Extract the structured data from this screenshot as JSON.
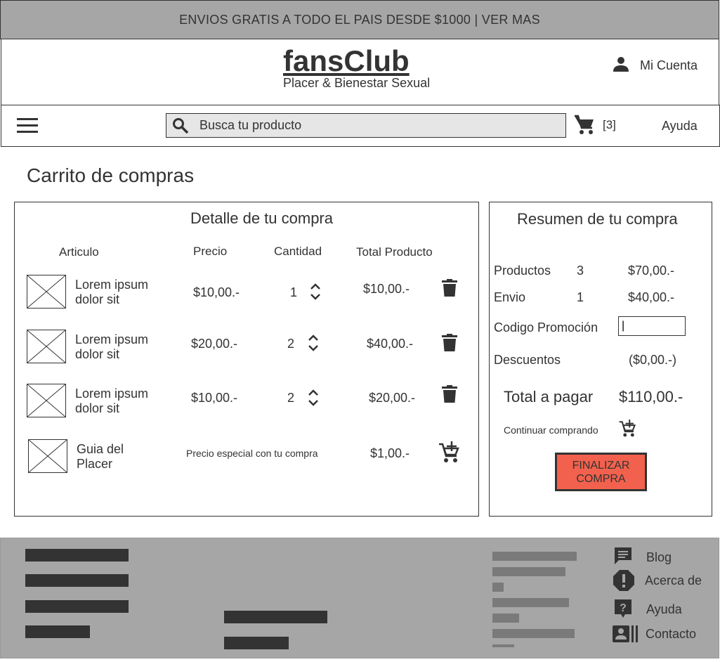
{
  "banner": {
    "text": "ENVIOS GRATIS A TODO EL PAIS DESDE $1000 | VER MAS"
  },
  "header": {
    "brand": "fansClub",
    "tagline": "Placer & Bienestar Sexual",
    "account_label": "Mi Cuenta",
    "account_icon": "person-icon"
  },
  "nav": {
    "menu_icon": "hamburger-menu-icon",
    "search_placeholder": "Busca tu producto",
    "cart_count": "[3]",
    "help_label": "Ayuda"
  },
  "page": {
    "title": "Carrito de compras"
  },
  "detail": {
    "title": "Detalle de tu compra",
    "columns": {
      "article": "Articulo",
      "price": "Precio",
      "quantity": "Cantidad",
      "total": "Total Producto"
    },
    "items": [
      {
        "name": "Lorem ipsum dolor sit",
        "price": "$10,00.-",
        "qty": "1",
        "total": "$10,00.-"
      },
      {
        "name": "Lorem ipsum dolor sit",
        "price": "$20,00.-",
        "qty": "2",
        "total": "$40,00.-"
      },
      {
        "name": "Lorem ipsum dolor sit",
        "price": "$10,00.-",
        "qty": "2",
        "total": "$20,00.-"
      }
    ],
    "special_item": {
      "name": "Guia del Placer",
      "note": "Precio especial con tu compra",
      "price": "$1,00.-"
    }
  },
  "summary": {
    "title": "Resumen de tu compra",
    "products_label": "Productos",
    "products_count": "3",
    "products_amount": "$70,00.-",
    "shipping_label": "Envio",
    "shipping_count": "1",
    "shipping_amount": "$40,00.-",
    "promo_label": "Codigo Promoción",
    "promo_value": "|",
    "discount_label": "Descuentos",
    "discount_amount": "($0,00.-)",
    "total_label": "Total a pagar",
    "total_amount": "$110,00.-",
    "continue_label": "Continuar comprando",
    "finalize_label": "FINALIZAR COMPRA"
  },
  "footer": {
    "links": [
      {
        "label": "Blog",
        "icon": "chat-icon"
      },
      {
        "label": "Acerca de",
        "icon": "alert-icon"
      },
      {
        "label": "Ayuda",
        "icon": "help-icon"
      },
      {
        "label": "Contacto",
        "icon": "contact-card-icon"
      }
    ]
  },
  "colors": {
    "banner_bg": "#a6a6a6",
    "text": "#333333",
    "search_bg": "#e6e6e6",
    "finalize_bg": "#f2614d",
    "footer_bg": "#a6a6a6"
  }
}
